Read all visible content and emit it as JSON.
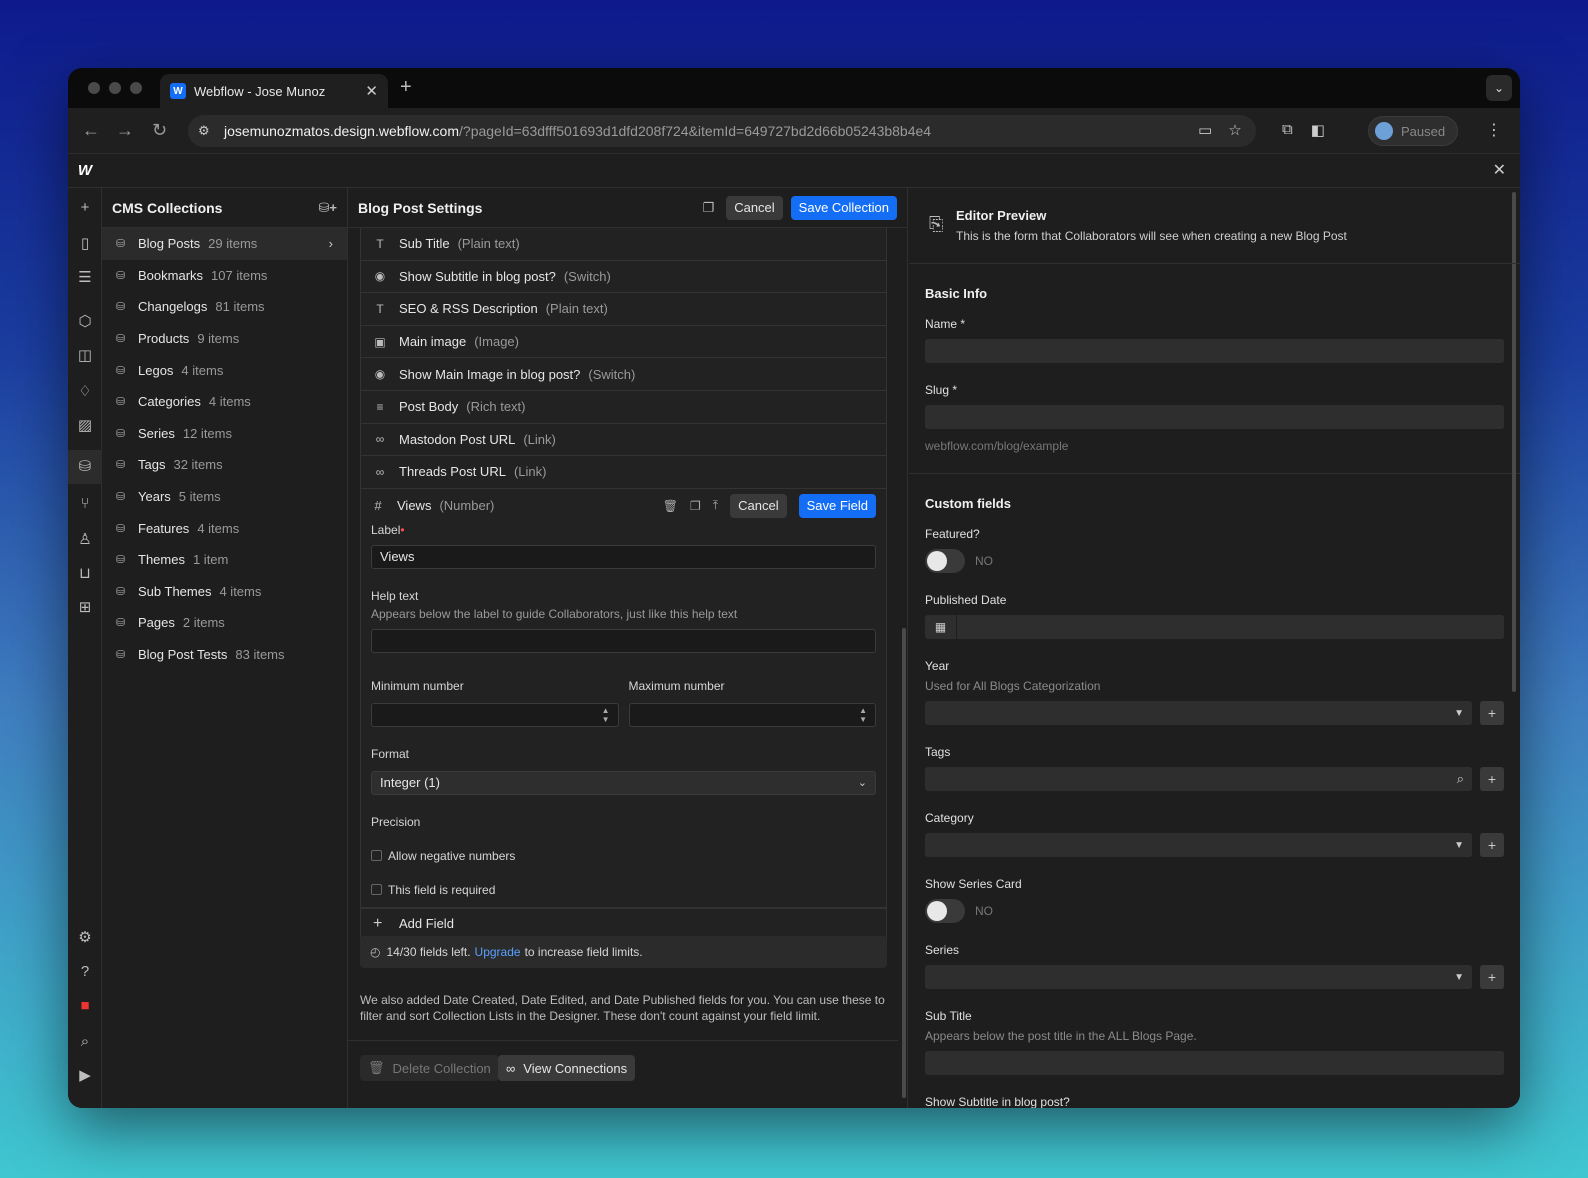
{
  "browser": {
    "tab_title": "Webflow - Jose Munoz",
    "url_host": "josemunozmatos.design.webflow.com",
    "url_path": "/?pageId=63dfff501693d1dfd208f724&itemId=649727bd2d66b05243b8b4e4",
    "profile_label": "Paused"
  },
  "collections": {
    "title": "CMS Collections",
    "items": [
      {
        "name": "Blog Posts",
        "count": "29 items"
      },
      {
        "name": "Bookmarks",
        "count": "107 items"
      },
      {
        "name": "Changelogs",
        "count": "81 items"
      },
      {
        "name": "Products",
        "count": "9 items"
      },
      {
        "name": "Legos",
        "count": "4 items"
      },
      {
        "name": "Categories",
        "count": "4 items"
      },
      {
        "name": "Series",
        "count": "12 items"
      },
      {
        "name": "Tags",
        "count": "32 items"
      },
      {
        "name": "Years",
        "count": "5 items"
      },
      {
        "name": "Features",
        "count": "4 items"
      },
      {
        "name": "Themes",
        "count": "1 item"
      },
      {
        "name": "Sub Themes",
        "count": "4 items"
      },
      {
        "name": "Pages",
        "count": "2 items"
      },
      {
        "name": "Blog Post Tests",
        "count": "83 items"
      }
    ]
  },
  "settings": {
    "title": "Blog Post Settings",
    "cancel": "Cancel",
    "save_collection": "Save Collection",
    "fields": [
      {
        "icon": "T",
        "name": "Sub Title",
        "type": "(Plain text)"
      },
      {
        "icon": "◉",
        "name": "Show Subtitle in blog post?",
        "type": "(Switch)"
      },
      {
        "icon": "T",
        "name": "SEO & RSS Description",
        "type": "(Plain text)"
      },
      {
        "icon": "▣",
        "name": "Main image",
        "type": "(Image)"
      },
      {
        "icon": "◉",
        "name": "Show Main Image in blog post?",
        "type": "(Switch)"
      },
      {
        "icon": "≡",
        "name": "Post Body",
        "type": "(Rich text)"
      },
      {
        "icon": "∞",
        "name": "Mastodon Post URL",
        "type": "(Link)"
      },
      {
        "icon": "∞",
        "name": "Threads Post URL",
        "type": "(Link)"
      }
    ],
    "editing": {
      "icon": "#",
      "name": "Views",
      "type": "(Number)",
      "cancel": "Cancel",
      "save": "Save Field",
      "label_label": "Label",
      "label_value": "Views",
      "help_label": "Help text",
      "help_hint": "Appears below the label to guide Collaborators, just like this help text",
      "min_label": "Minimum number",
      "max_label": "Maximum number",
      "format_label": "Format",
      "format_value": "Integer (1)",
      "precision_label": "Precision",
      "allow_negative": "Allow negative numbers",
      "required": "This field is required"
    },
    "add_field": "Add Field",
    "limits_prefix": "14/30 fields left.",
    "limits_link": "Upgrade",
    "limits_suffix": "to increase field limits.",
    "note": "We also added Date Created, Date Edited, and Date Published fields for you. You can use these to filter and sort Collection Lists in the Designer. These don't count against your field limit.",
    "delete_collection": "Delete Collection",
    "view_connections": "View Connections"
  },
  "preview": {
    "title": "Editor Preview",
    "subtitle": "This is the form that Collaborators will see when creating a new Blog Post",
    "basic_title": "Basic Info",
    "name_label": "Name *",
    "slug_label": "Slug *",
    "slug_hint": "webflow.com/blog/example",
    "custom_title": "Custom fields",
    "featured_label": "Featured?",
    "no": "NO",
    "published_label": "Published Date",
    "year_label": "Year",
    "year_hint": "Used for All Blogs Categorization",
    "tags_label": "Tags",
    "category_label": "Category",
    "series_card_label": "Show Series Card",
    "series_label": "Series",
    "subtitle_label": "Sub Title",
    "subtitle_hint": "Appears below the post title in the ALL Blogs Page.",
    "show_subtitle_label": "Show Subtitle in blog post?"
  }
}
